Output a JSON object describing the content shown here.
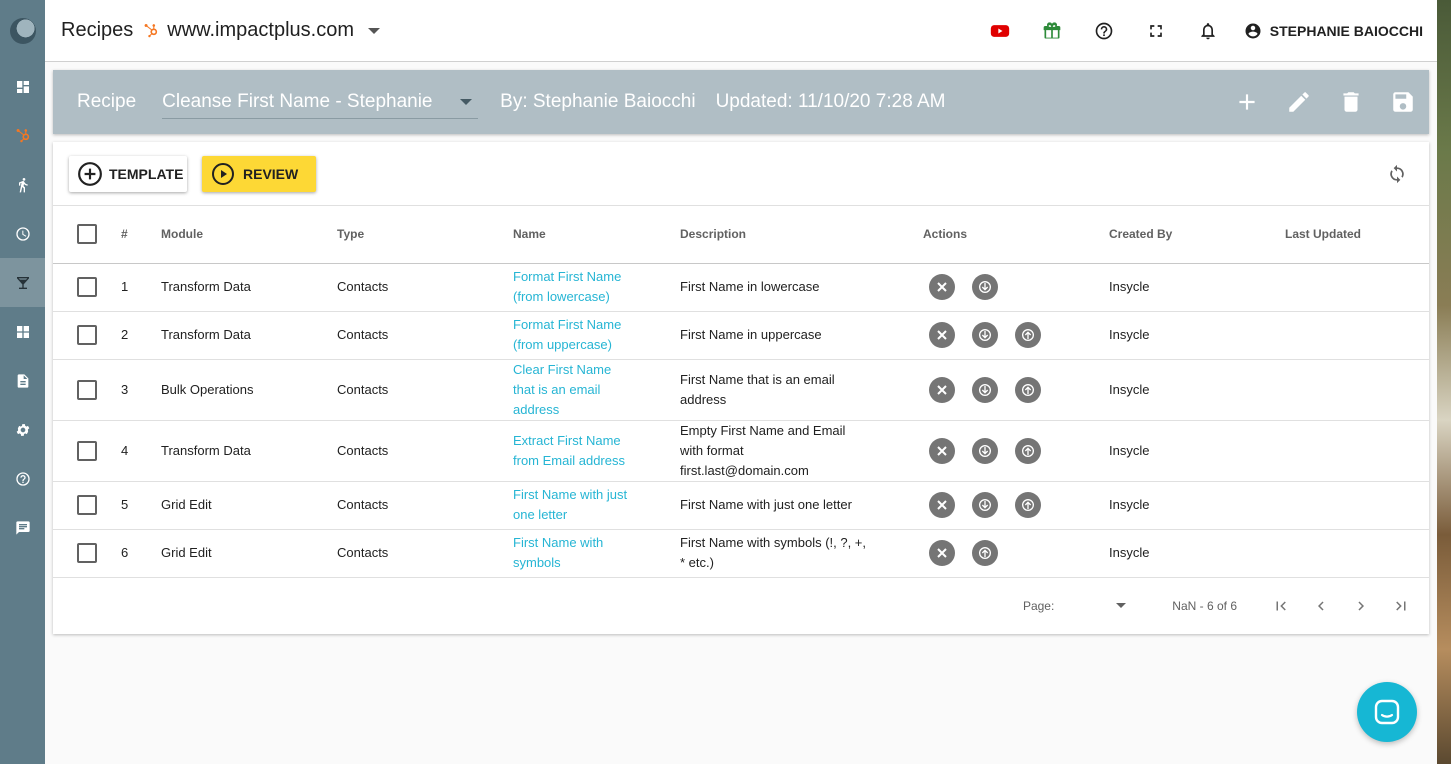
{
  "header": {
    "title": "Recipes",
    "site": "www.impactplus.com",
    "icons": [
      "youtube-icon",
      "gift-icon",
      "help-icon",
      "fullscreen-icon",
      "bell-icon"
    ],
    "user_name": "STEPHANIE BAIOCCHI"
  },
  "sidebar": {
    "items": [
      "dashboard-icon",
      "hubspot-icon",
      "run-icon",
      "history-icon",
      "recipes-icon",
      "apps-icon",
      "document-icon",
      "settings-icon",
      "help-icon",
      "chat-icon"
    ],
    "active": "recipes-icon"
  },
  "recipe_bar": {
    "label": "Recipe",
    "selected_recipe": "Cleanse First Name - Stephanie",
    "by": "By: Stephanie Baiocchi",
    "updated": "Updated: 11/10/20 7:28 AM",
    "actions": [
      "add-icon",
      "edit-icon",
      "delete-icon",
      "save-icon"
    ]
  },
  "toolbar": {
    "template_label": "TEMPLATE",
    "review_label": "REVIEW"
  },
  "table": {
    "headers": {
      "num": "#",
      "module": "Module",
      "type": "Type",
      "name": "Name",
      "description": "Description",
      "actions": "Actions",
      "created_by": "Created By",
      "last_updated": "Last Updated"
    },
    "rows": [
      {
        "num": "1",
        "module": "Transform Data",
        "type": "Contacts",
        "name": "Format First Name (from lowercase)",
        "description": "First Name in lowercase",
        "created_by": "Insycle",
        "last_updated": ""
      },
      {
        "num": "2",
        "module": "Transform Data",
        "type": "Contacts",
        "name": "Format First Name (from uppercase)",
        "description": "First Name in uppercase",
        "created_by": "Insycle",
        "last_updated": ""
      },
      {
        "num": "3",
        "module": "Bulk Operations",
        "type": "Contacts",
        "name": "Clear First Name that is an email address",
        "description": "First Name that is an email address",
        "created_by": "Insycle",
        "last_updated": ""
      },
      {
        "num": "4",
        "module": "Transform Data",
        "type": "Contacts",
        "name": "Extract First Name from Email address",
        "description": "Empty First Name and Email with format first.last@domain.com",
        "created_by": "Insycle",
        "last_updated": ""
      },
      {
        "num": "5",
        "module": "Grid Edit",
        "type": "Contacts",
        "name": "First Name with just one letter",
        "description": "First Name with just one letter",
        "created_by": "Insycle",
        "last_updated": ""
      },
      {
        "num": "6",
        "module": "Grid Edit",
        "type": "Contacts",
        "name": "First Name with symbols",
        "description": "First Name with symbols (!, ?, +, * etc.)",
        "created_by": "Insycle",
        "last_updated": ""
      }
    ]
  },
  "pager": {
    "page_label": "Page:",
    "page_value": "",
    "range": "NaN - 6 of 6"
  },
  "colors": {
    "sidebar": "#5f7c89",
    "recipe_bar": "#b0bec5",
    "link": "#26b5d4",
    "review_button": "#fdd835",
    "chat_button": "#16b7d4"
  }
}
